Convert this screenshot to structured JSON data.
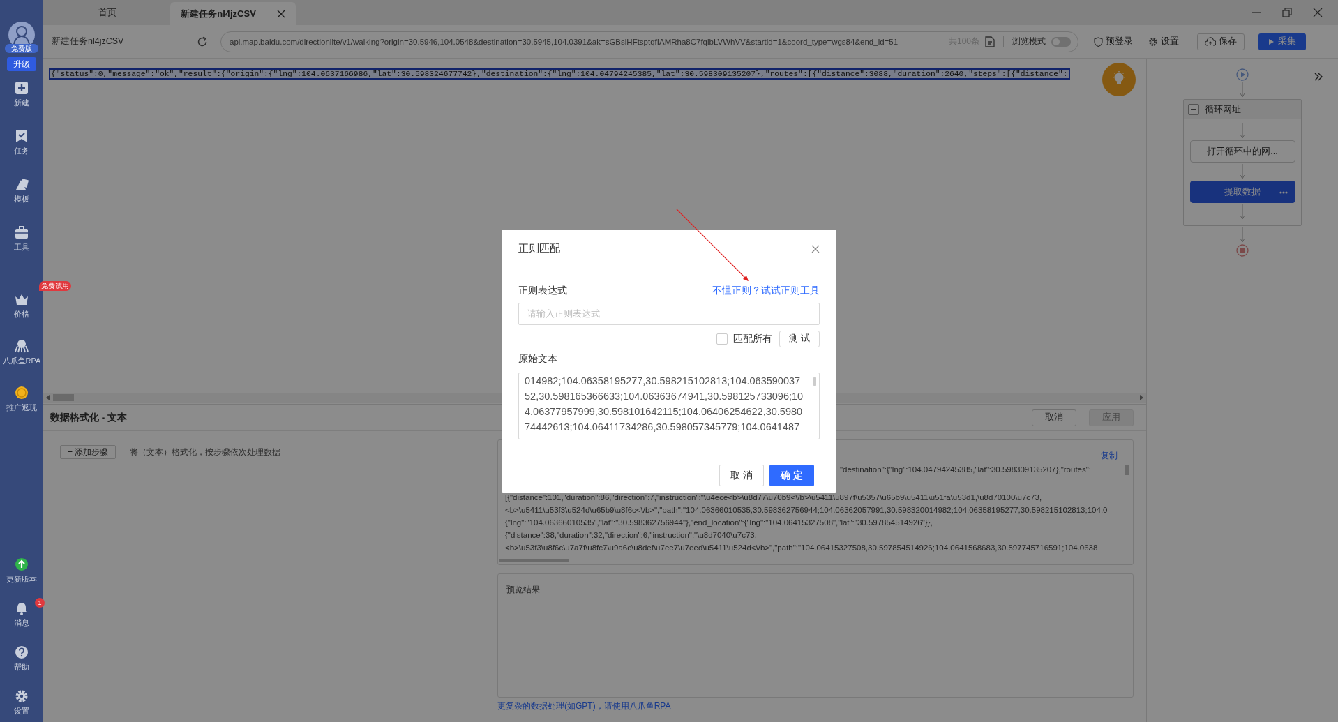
{
  "sidebar": {
    "avatar_badge": "免费版",
    "upgrade": "升级",
    "top_items": [
      {
        "label": "新建"
      },
      {
        "label": "任务"
      },
      {
        "label": "模板"
      },
      {
        "label": "工具"
      }
    ],
    "middle_items": [
      {
        "label": "价格",
        "badge": "免费试用"
      },
      {
        "label": "八爪鱼RPA"
      },
      {
        "label": "推广返现"
      }
    ],
    "bottom_items": [
      {
        "label": "更新版本"
      },
      {
        "label": "消息",
        "badge": "1"
      },
      {
        "label": "帮助"
      },
      {
        "label": "设置"
      }
    ]
  },
  "tabs": [
    {
      "label": "首页",
      "selected": false
    },
    {
      "label": "新建任务nl4jzCSV",
      "selected": true
    }
  ],
  "toolbar": {
    "task_name": "新建任务nl4jzCSV",
    "url": "api.map.baidu.com/directionlite/v1/walking?origin=30.5946,104.0548&destination=30.5945,104.0391&ak=sGBsiHFtsptqfIAMRha8C7fqibLVWhVV&startid=1&coord_type=wgs84&end_id=51",
    "count": "共100条",
    "browse_mode": {
      "label": "浏览模式",
      "on": false
    },
    "prelogin": "预登录",
    "settings": "设置",
    "save": "保存",
    "collect": "采集"
  },
  "page_text": "{\"status\":0,\"message\":\"ok\",\"result\":{\"origin\":{\"lng\":104.0637166986,\"lat\":30.598324677742},\"destination\":{\"lng\":104.04794245385,\"lat\":30.598309135207},\"routes\":[{\"distance\":3088,\"duration\":2640,\"steps\":[{\"distance\":",
  "workflow": {
    "loop": {
      "label": "循环网址",
      "expanded": true,
      "steps": [
        {
          "label": "打开循环中的网...",
          "selected": false
        },
        {
          "label": "提取数据",
          "selected": true
        }
      ]
    }
  },
  "format_panel": {
    "title": "数据格式化 - 文本",
    "cancel": {
      "label": "取消",
      "disabled": false
    },
    "apply": {
      "label": "应用",
      "disabled": true
    },
    "add_step": "+ 添加步骤",
    "description": "将（文本）格式化，按步骤依次处理数据",
    "copy": "复制",
    "source_lines": [
      "\"destination\":{\"lng\":104.04794245385,\"lat\":30.598309135207},\"routes\":",
      "[{\"distance\":101,\"duration\":86,\"direction\":7,\"instruction\":\"\\u4ece<b>\\u8d77\\u70b9<\\/b>\\u5411\\u897f\\u5357\\u65b9\\u5411\\u51fa\\u53d1,\\u8d70100\\u7c73,",
      "<b>\\u5411\\u53f3\\u524d\\u65b9\\u8f6c<\\/b>\",\"path\":\"104.06366010535,30.598362756944;104.06362057991,30.598320014982;104.06358195277,30.598215102813;104.0",
      "{\"lng\":\"104.06366010535\",\"lat\":\"30.598362756944\"},\"end_location\":{\"lng\":\"104.06415327508\",\"lat\":\"30.597854514926\"}},",
      "{\"distance\":38,\"duration\":32,\"direction\":6,\"instruction\":\"\\u8d7040\\u7c73,",
      "<b>\\u53f3\\u8f6c\\u7a7f\\u8fc7\\u9a6c\\u8def\\u7ee7\\u7eed\\u5411\\u524d<\\/b>\",\"path\":\"104.06415327508,30.597854514926;104.0641568683,30.597745716591;104.0638"
    ],
    "preview_label": "预览结果",
    "rpa_link": "更复杂的数据处理(如GPT)，请使用八爪鱼RPA"
  },
  "dialog": {
    "title": "正则匹配",
    "regex_label": "正则表达式",
    "help_link": "不懂正则？试试正则工具",
    "regex_placeholder": "请输入正则表达式",
    "match_all": {
      "label": "匹配所有",
      "checked": false
    },
    "test": "测 试",
    "source_label": "原始文本",
    "source_text": "014982;104.06358195277,30.598215102813;104.06359003752,30.598165366633;104.06363674941,30.598125733096;104.06377957999,30.598101642115;104.06406254622,30.598074442613;104.06411734286,30.598057345779;104.0641487",
    "cancel": "取 消",
    "ok": "确 定"
  }
}
